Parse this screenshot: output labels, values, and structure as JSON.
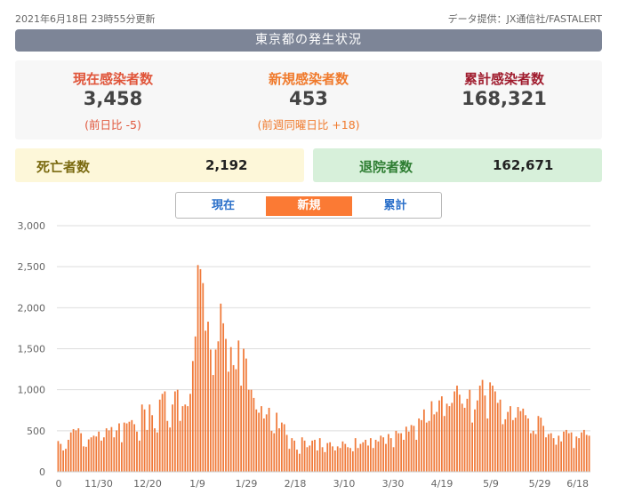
{
  "topbar": {
    "updated": "2021年6月18日 23時55分更新",
    "source": "データ提供：JX通信社/FASTALERT"
  },
  "header": {
    "title": "東京都の発生状況"
  },
  "stats": {
    "current": {
      "label": "現在感染者数",
      "value": "3,458",
      "sub": "(前日比 -5)",
      "color": "#e0553a"
    },
    "new": {
      "label": "新規感染者数",
      "value": "453",
      "sub": "(前週同曜日比 +18)",
      "color": "#f07a2c"
    },
    "total": {
      "label": "累計感染者数",
      "value": "168,321",
      "color": "#a01c2e"
    }
  },
  "deaths": {
    "label": "死亡者数",
    "value": "2,192"
  },
  "recovered": {
    "label": "退院者数",
    "value": "162,671"
  },
  "tabs": [
    {
      "label": "現在",
      "active": false
    },
    {
      "label": "新規",
      "active": true
    },
    {
      "label": "累計",
      "active": false
    }
  ],
  "colors": {
    "bar": "#f07a3a",
    "bar_stroke": "#e56a28",
    "grid": "#dddddd",
    "tab_active": "#fb7a34"
  },
  "chart_data": {
    "type": "bar",
    "title": "",
    "xlabel": "",
    "ylabel": "",
    "ylim": [
      0,
      3000
    ],
    "yticks": [
      "0",
      "500",
      "1,000",
      "1,500",
      "2,000",
      "2,500",
      "3,000"
    ],
    "xticks": [
      "0",
      "11/30",
      "12/20",
      "1/9",
      "1/29",
      "2/18",
      "3/10",
      "3/30",
      "4/19",
      "5/9",
      "5/29",
      "6/18"
    ],
    "grid": true,
    "legend": "none",
    "series": [
      {
        "values": [
          375,
          340,
          260,
          280,
          390,
          480,
          520,
          505,
          530,
          470,
          310,
          305,
          395,
          420,
          440,
          430,
          490,
          380,
          420,
          530,
          505,
          545,
          420,
          505,
          590,
          360,
          600,
          590,
          610,
          630,
          580,
          490,
          380,
          820,
          760,
          510,
          820,
          690,
          530,
          480,
          880,
          950,
          980,
          620,
          540,
          820,
          980,
          1000,
          620,
          800,
          820,
          800,
          950,
          1350,
          1650,
          2520,
          2470,
          2300,
          1720,
          1830,
          1490,
          1180,
          1490,
          1590,
          2050,
          1810,
          1620,
          1220,
          1520,
          1300,
          1250,
          1600,
          1050,
          1500,
          1380,
          1000,
          1000,
          900,
          760,
          720,
          800,
          650,
          700,
          780,
          500,
          470,
          720,
          530,
          600,
          580,
          450,
          280,
          410,
          380,
          270,
          220,
          420,
          380,
          300,
          320,
          380,
          390,
          260,
          410,
          300,
          240,
          350,
          360,
          310,
          260,
          310,
          290,
          370,
          340,
          300,
          290,
          250,
          410,
          290,
          340,
          360,
          390,
          320,
          410,
          290,
          390,
          370,
          440,
          420,
          340,
          460,
          410,
          300,
          500,
          470,
          470,
          390,
          550,
          490,
          570,
          560,
          390,
          650,
          630,
          760,
          600,
          620,
          860,
          700,
          730,
          870,
          920,
          680,
          830,
          800,
          840,
          980,
          1050,
          940,
          830,
          780,
          890,
          1000,
          600,
          760,
          870,
          1050,
          1120,
          930,
          650,
          1090,
          1050,
          980,
          840,
          880,
          580,
          640,
          730,
          800,
          630,
          660,
          790,
          740,
          770,
          690,
          650,
          470,
          500,
          460,
          680,
          660,
          560,
          420,
          460,
          470,
          410,
          330,
          440,
          370,
          490,
          510,
          470,
          480,
          290,
          430,
          410,
          480,
          510,
          450,
          440
        ]
      }
    ]
  }
}
